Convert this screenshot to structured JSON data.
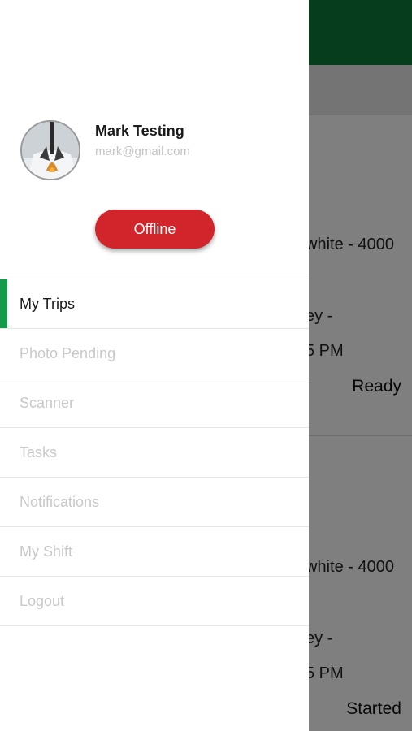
{
  "background": {
    "card1": {
      "line1": "white - 4000",
      "line2": "ey -",
      "line3": "5 PM",
      "status": "Ready"
    },
    "card2": {
      "line1": "white - 4000",
      "line2": "ey -",
      "line3": "5 PM",
      "status": "Started"
    }
  },
  "drawer": {
    "user": {
      "name": "Mark Testing",
      "email": "mark@gmail.com"
    },
    "status_button": "Offline",
    "menu": [
      {
        "label": "My Trips",
        "active": true
      },
      {
        "label": "Photo Pending",
        "active": false
      },
      {
        "label": "Scanner",
        "active": false
      },
      {
        "label": "Tasks",
        "active": false
      },
      {
        "label": "Notifications",
        "active": false
      },
      {
        "label": "My Shift",
        "active": false
      },
      {
        "label": "Logout",
        "active": false
      }
    ]
  },
  "colors": {
    "header_green": "#0d7a3a",
    "active_indicator": "#139a4a",
    "status_button": "#d1242b"
  }
}
